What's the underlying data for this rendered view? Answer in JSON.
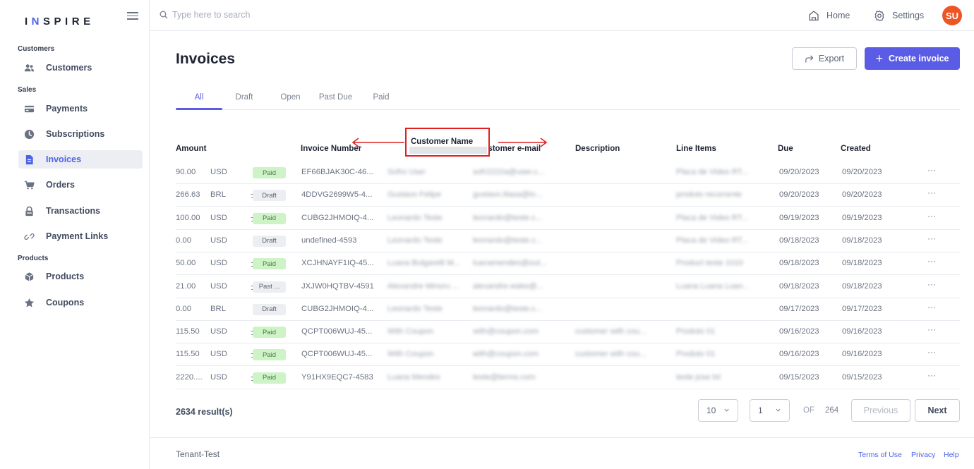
{
  "brand": {
    "logo": "INSPIRE"
  },
  "sidebar": {
    "sections": [
      {
        "label": "Customers"
      },
      {
        "label": "Sales"
      },
      {
        "label": "Products"
      }
    ],
    "items": [
      {
        "label": "Customers",
        "icon": "users-icon"
      },
      {
        "label": "Payments",
        "icon": "credit-card-icon"
      },
      {
        "label": "Subscriptions",
        "icon": "clock-icon"
      },
      {
        "label": "Invoices",
        "icon": "document-icon",
        "active": true
      },
      {
        "label": "Orders",
        "icon": "cart-icon"
      },
      {
        "label": "Transactions",
        "icon": "lock-icon"
      },
      {
        "label": "Payment Links",
        "icon": "link-icon"
      },
      {
        "label": "Products",
        "icon": "box-icon"
      },
      {
        "label": "Coupons",
        "icon": "star-icon"
      }
    ]
  },
  "topbar": {
    "search_placeholder": "Type here to search",
    "home_label": "Home",
    "settings_label": "Settings",
    "avatar_initials": "SU"
  },
  "page": {
    "title": "Invoices",
    "export_label": "Export",
    "create_label": "Create invoice"
  },
  "tabs": [
    "All",
    "Draft",
    "Open",
    "Past Due",
    "Paid"
  ],
  "table": {
    "headers": {
      "amount": "Amount",
      "invoice_number": "Invoice Number",
      "customer_email": "Customer e-mail",
      "description": "Description",
      "line_items": "Line Items",
      "due": "Due",
      "created": "Created"
    },
    "rows": [
      {
        "amount": "90.00",
        "currency": "USD",
        "recurring": false,
        "status": "Paid",
        "invoice": "EF66BJAK30C-46...",
        "customer": "Sofro User",
        "email": "sofr2222a@user.c...",
        "description": "",
        "line_items": "Placa de Video RT...",
        "due": "09/20/2023",
        "created": "09/20/2023"
      },
      {
        "amount": "266.63",
        "currency": "BRL",
        "recurring": true,
        "status": "Draft",
        "invoice": "4DDVG2699W5-4...",
        "customer": "Gustavo Felipe",
        "email": "gustavo.lilasa@in...",
        "description": "",
        "line_items": "produto recorrente",
        "due": "09/20/2023",
        "created": "09/20/2023"
      },
      {
        "amount": "100.00",
        "currency": "USD",
        "recurring": true,
        "status": "Paid",
        "invoice": "CUBG2JHMOIQ-4...",
        "customer": "Leonardo Teste",
        "email": "leonardo@teste.c...",
        "description": "",
        "line_items": "Placa de Video RT...",
        "due": "09/19/2023",
        "created": "09/19/2023"
      },
      {
        "amount": "0.00",
        "currency": "USD",
        "recurring": false,
        "status": "Draft",
        "invoice": "undefined-4593",
        "customer": "Leonardo Teste",
        "email": "leonardo@teste.c...",
        "description": "",
        "line_items": "Placa de Video RT...",
        "due": "09/18/2023",
        "created": "09/18/2023"
      },
      {
        "amount": "50.00",
        "currency": "USD",
        "recurring": true,
        "status": "Paid",
        "invoice": "XCJHNAYF1IQ-45...",
        "customer": "Luana Bulgarelli M...",
        "email": "luanamendes@out...",
        "description": "",
        "line_items": "Product teste 1010",
        "due": "09/18/2023",
        "created": "09/18/2023"
      },
      {
        "amount": "21.00",
        "currency": "USD",
        "recurring": true,
        "status": "Past ...",
        "invoice": "JXJW0HQTBV-4591",
        "customer": "Alexandre Minoru ...",
        "email": "alexandre.wake@...",
        "description": "",
        "line_items": "Luana Luana Luan...",
        "due": "09/18/2023",
        "created": "09/18/2023"
      },
      {
        "amount": "0.00",
        "currency": "BRL",
        "recurring": false,
        "status": "Draft",
        "invoice": "CUBG2JHMOIQ-4...",
        "customer": "Leonardo Teste",
        "email": "leonardo@teste.c...",
        "description": "",
        "line_items": "",
        "due": "09/17/2023",
        "created": "09/17/2023"
      },
      {
        "amount": "115.50",
        "currency": "USD",
        "recurring": true,
        "status": "Paid",
        "invoice": "QCPT006WUJ-45...",
        "customer": "With Coupon",
        "email": "with@coupon.com",
        "description": "customer with cou...",
        "line_items": "Produto 01",
        "due": "09/16/2023",
        "created": "09/16/2023"
      },
      {
        "amount": "115.50",
        "currency": "USD",
        "recurring": true,
        "status": "Paid",
        "invoice": "QCPT006WUJ-45...",
        "customer": "With Coupon",
        "email": "with@coupon.com",
        "description": "customer with cou...",
        "line_items": "Produto 01",
        "due": "09/16/2023",
        "created": "09/16/2023"
      },
      {
        "amount": "2220....",
        "currency": "USD",
        "recurring": true,
        "status": "Paid",
        "invoice": "Y91HX9EQC7-4583",
        "customer": "Luana Mendes",
        "email": "teste@terms.com",
        "description": "",
        "line_items": "teste jose lol",
        "due": "09/15/2023",
        "created": "09/15/2023"
      }
    ]
  },
  "annotation": {
    "label": "Customer Name"
  },
  "pagination": {
    "results": "2634 result(s)",
    "page_size": "10",
    "page": "1",
    "of_label": "OF",
    "total_pages": "264",
    "previous_label": "Previous",
    "next_label": "Next"
  },
  "footer": {
    "tenant": "Tenant-Test",
    "links": [
      "Terms of Use",
      "Privacy",
      "Help"
    ]
  },
  "colors": {
    "accent": "#5b5ce6",
    "avatar": "#ee5525",
    "paid_badge": "#cdf3c6",
    "annotation": "#e02020"
  }
}
